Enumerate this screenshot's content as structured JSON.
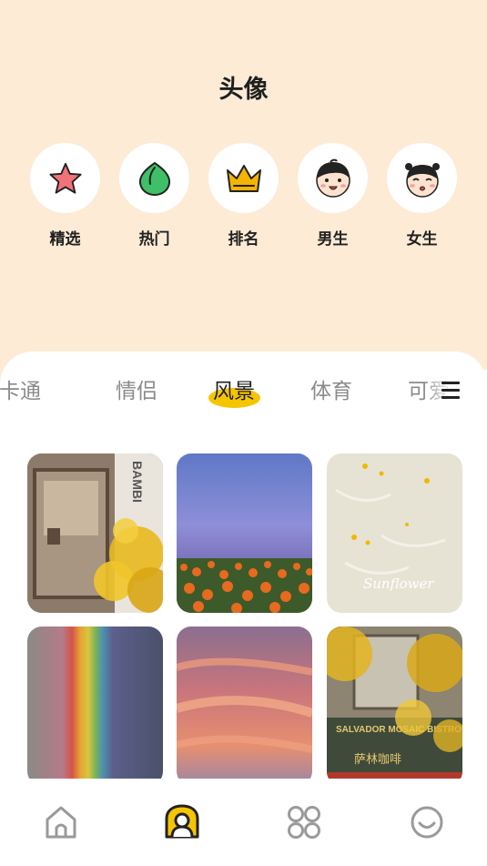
{
  "header": {
    "title": "头像"
  },
  "categories": [
    {
      "label": "精选",
      "icon": "star-icon"
    },
    {
      "label": "热门",
      "icon": "leaf-icon"
    },
    {
      "label": "排名",
      "icon": "crown-icon"
    },
    {
      "label": "男生",
      "icon": "boy-face-icon"
    },
    {
      "label": "女生",
      "icon": "girl-face-icon"
    }
  ],
  "tabs": [
    {
      "label": "卡通",
      "active": false
    },
    {
      "label": "情侣",
      "active": false
    },
    {
      "label": "风景",
      "active": true
    },
    {
      "label": "体育",
      "active": false
    },
    {
      "label": "可爱",
      "active": false
    }
  ],
  "grid": {
    "images": [
      {
        "subject": "cafe-storefront-ginkgo",
        "sign_text": "BAMBI"
      },
      {
        "subject": "purple-sky-flower-field"
      },
      {
        "subject": "cream-wall-yellow-petals",
        "handwriting": "Sunflower"
      },
      {
        "subject": "rainbow-sky"
      },
      {
        "subject": "sunset-clouds"
      },
      {
        "subject": "bistro-ginkgo-tree",
        "sign_text": "SALVADOR MOSAIC BISTRO",
        "sign_text_cn": "萨林咖啡"
      }
    ]
  },
  "bottom_nav": [
    {
      "icon": "home-icon",
      "active": false
    },
    {
      "icon": "avatar-icon",
      "active": true
    },
    {
      "icon": "grid-icon",
      "active": false
    },
    {
      "icon": "smile-icon",
      "active": false
    }
  ],
  "colors": {
    "background": "#fdebd6",
    "accent": "#f5c500",
    "star": "#f2727a",
    "leaf": "#3fbf68",
    "crown": "#f5b400",
    "active_tab_text": "#1f1f1f",
    "inactive_tab_text": "#8a8a8a"
  }
}
